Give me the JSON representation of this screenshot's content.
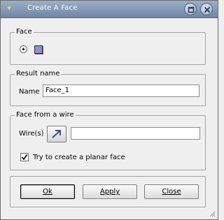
{
  "window": {
    "title": "Create A Face",
    "app_icon": "pin-icon",
    "titlebar_buttons": [
      "minimize-icon",
      "close-icon"
    ],
    "colors": {
      "titlebar": "#7f95b3",
      "face_icon": "#8f93c9",
      "background": "#efefef"
    }
  },
  "face_group": {
    "title": "Face",
    "selected_icon": "face-icon"
  },
  "result_group": {
    "title": "Result name",
    "name_label": "Name",
    "name_value": "Face_1"
  },
  "wire_group": {
    "title": "Face from a wire",
    "wires_label": "Wire(s)",
    "wires_value": "",
    "select_icon": "arrow-select-icon",
    "planar_checkbox_label": "Try to create a planar face",
    "planar_checked": true
  },
  "buttons": {
    "ok": "Ok",
    "apply": "Apply",
    "close": "Close"
  }
}
